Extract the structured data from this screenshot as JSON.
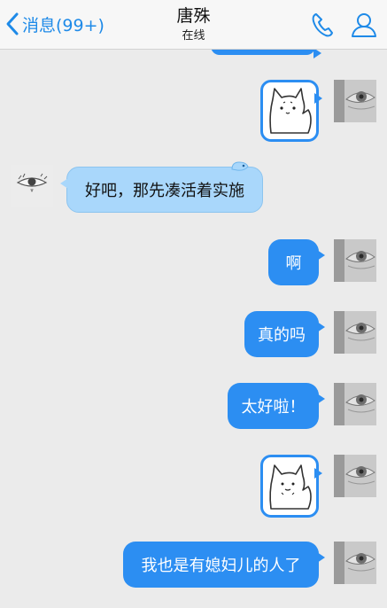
{
  "header": {
    "back_label": "消息(99+)",
    "contact_name": "唐殊",
    "status": "在线"
  },
  "messages": [
    {
      "from": "me",
      "type": "sticker"
    },
    {
      "from": "them",
      "type": "text",
      "text": "好吧，那先凑活着实施"
    },
    {
      "from": "me",
      "type": "text",
      "text": "啊"
    },
    {
      "from": "me",
      "type": "text",
      "text": "真的吗"
    },
    {
      "from": "me",
      "type": "text",
      "text": "太好啦！"
    },
    {
      "from": "me",
      "type": "sticker"
    },
    {
      "from": "me",
      "type": "text",
      "text": "我也是有媳妇儿的人了"
    }
  ],
  "colors": {
    "accent": "#1e8ae8",
    "outgoing_bubble": "#2c8ef2",
    "incoming_bubble": "#a9d7fb",
    "background": "#ebebeb"
  },
  "icons": [
    "chevron-left-icon",
    "phone-icon",
    "contact-icon",
    "cat-sticker",
    "eye-avatar"
  ]
}
